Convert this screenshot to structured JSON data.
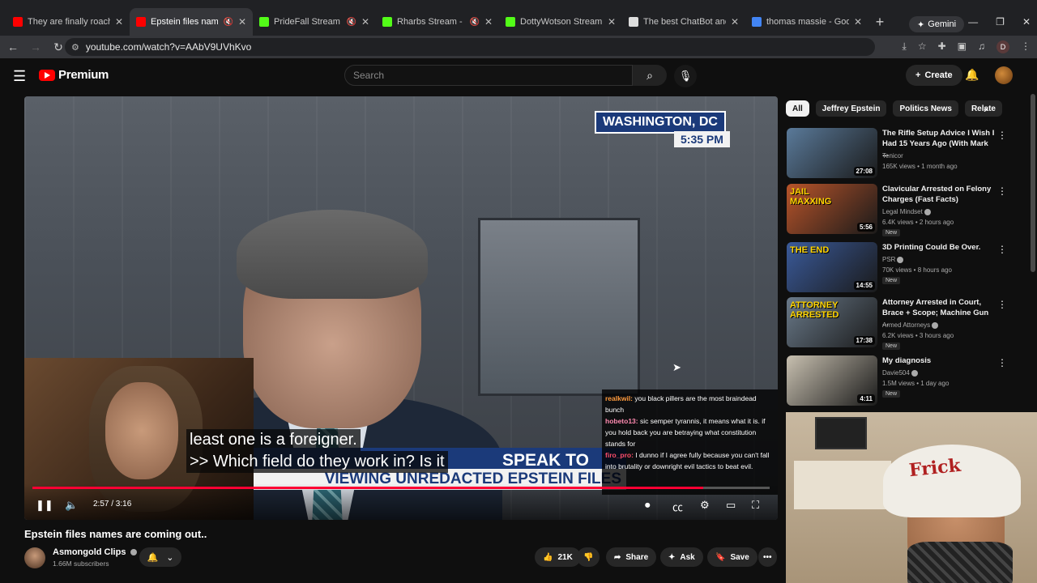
{
  "browser": {
    "tabs": [
      {
        "title": "They are finally roaching out.",
        "color": "#ff0000",
        "muted": false,
        "active": false
      },
      {
        "title": "Epstein files names are coming out",
        "color": "#ff0000",
        "muted": true,
        "active": true
      },
      {
        "title": "PrideFall Stream - Watch",
        "color": "#53fc18",
        "muted": true,
        "active": false
      },
      {
        "title": "Rharbs Stream - Watch Live",
        "color": "#53fc18",
        "muted": true,
        "active": false
      },
      {
        "title": "DottyWotson Stream - Watch",
        "color": "#53fc18",
        "muted": false,
        "active": false
      },
      {
        "title": "The best ChatBot and Widget",
        "color": "#dddddd",
        "muted": false,
        "active": false
      },
      {
        "title": "thomas massie - Google Search",
        "color": "#4285f4",
        "muted": false,
        "active": false
      }
    ],
    "gemini_label": "Gemini",
    "url": "youtube.com/watch?v=AAbV9UVhKvo",
    "profile_letter": "D"
  },
  "yt_header": {
    "logo_text": "Premium",
    "search_placeholder": "Search",
    "create_label": "Create"
  },
  "player": {
    "location_badge": "WASHINGTON, DC",
    "time_badge": "5:35 PM",
    "chyron_line1": "SPEAK TO",
    "chyron_line2": "VIEWING UNREDACTED EPSTEIN FILES",
    "caption_line1": "least one is a foreigner.",
    "caption_line2": ">> Which field do they work in? Is it",
    "time_display": "2:57 / 3:16",
    "progress": 0.91,
    "chat": [
      {
        "user": "realkwil:",
        "message": "you black pillers are the most braindead bunch"
      },
      {
        "user": "hobeto13:",
        "message": "sic semper tyrannis, it means what it is. if you hold back you are betraying what constitution stands for"
      },
      {
        "user": "firo_pro:",
        "message": "I dunno if I agree fully because you can't fall into brutality or downright evil tactics to beat evil."
      }
    ]
  },
  "video": {
    "title": "Epstein files names are coming out..",
    "channel": "Asmongold Clips",
    "subscribers": "1.66M subscribers",
    "likes": "21K",
    "share_label": "Share",
    "ask_label": "Ask",
    "save_label": "Save"
  },
  "chips": [
    "All",
    "Jeffrey Epstein",
    "Politics News",
    "Relate"
  ],
  "recommendations": [
    {
      "title": "The Rifle Setup Advice I Wish I Had 15 Years Ago (With Mark ...",
      "channel": "Tenicor",
      "verified": false,
      "stats": "165K views • 1 month ago",
      "duration": "27:08",
      "new": "",
      "thumb_color": "#5a7a9a"
    },
    {
      "title": "Clavicular Arrested on Felony Charges (Fast Facts)",
      "channel": "Legal Mindset",
      "verified": true,
      "stats": "6.4K views • 2 hours ago",
      "duration": "5:56",
      "new": "New",
      "thumb_color": "#b8542a"
    },
    {
      "title": "3D Printing Could Be Over.",
      "channel": "PSR",
      "verified": true,
      "stats": "70K views • 8 hours ago",
      "duration": "14:55",
      "new": "New",
      "thumb_color": "#3a5a9a"
    },
    {
      "title": "Attorney Arrested in Court, Brace + Scope; Machine Gun ...",
      "channel": "Armed Attorneys",
      "verified": true,
      "stats": "6.2K views • 3 hours ago",
      "duration": "17:38",
      "new": "New",
      "thumb_color": "#6a7a8a"
    },
    {
      "title": "My diagnosis",
      "channel": "Davie504",
      "verified": true,
      "stats": "1.5M views • 1 day ago",
      "duration": "4:11",
      "new": "New",
      "thumb_color": "#c8c0b0"
    }
  ],
  "thumb_text": {
    "r1": "JAIL MAXXING",
    "r2": "THE END",
    "r3": "ATTORNEY ARRESTED"
  },
  "webcam2": {
    "cap_text": "Frick"
  }
}
